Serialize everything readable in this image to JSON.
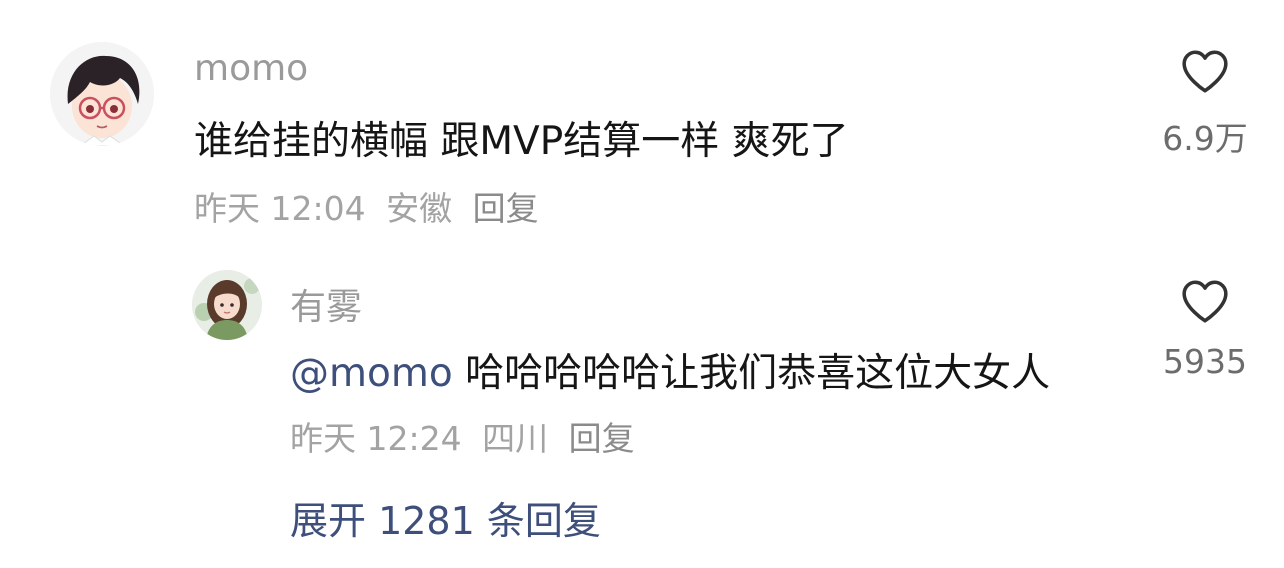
{
  "comments": [
    {
      "username": "momo",
      "text": "谁给挂的横幅 跟MVP结算一样 爽死了",
      "time": "昨天 12:04",
      "location": "安徽",
      "reply_label": "回复",
      "likes": "6.9万"
    }
  ],
  "replies": [
    {
      "username": "有雾",
      "mention": "@momo",
      "text": "哈哈哈哈哈让我们恭喜这位大女人",
      "time": "昨天 12:24",
      "location": "四川",
      "reply_label": "回复",
      "likes": "5935"
    }
  ],
  "expand_label": "展开 1281 条回复",
  "icons": {
    "like": "heart-outline-icon"
  },
  "colors": {
    "mention": "#3d4f7a",
    "meta": "#a3a3a3",
    "username": "#9a9a9a"
  }
}
